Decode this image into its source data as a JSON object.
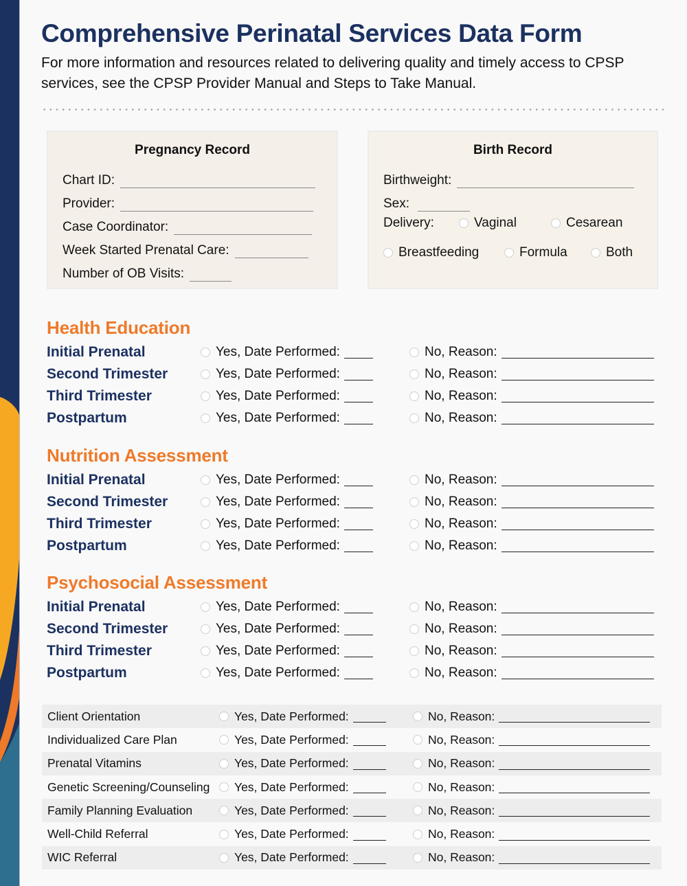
{
  "header": {
    "title": "Comprehensive Perinatal Services Data Form",
    "intro": "For more information and resources related to delivering quality and timely access to CPSP services, see the CPSP Provider Manual and Steps to Take Manual."
  },
  "colors": {
    "navy": "#1b3160",
    "orange_heading": "#ee7a2a",
    "accent_yellow": "#f7a823",
    "accent_orange": "#ee7a2a",
    "accent_teal": "#2e6e8e",
    "box_beige": "#f5efe9"
  },
  "pregnancy_record": {
    "title": "Pregnancy Record",
    "fields": [
      {
        "label": "Chart ID:",
        "value": ""
      },
      {
        "label": "Provider:",
        "value": ""
      },
      {
        "label": "Case Coordinator:",
        "value": ""
      },
      {
        "label": "Week Started Prenatal Care:",
        "value": ""
      },
      {
        "label": "Number of OB Visits:",
        "value": ""
      }
    ]
  },
  "birth_record": {
    "title": "Birth Record",
    "birthweight_label": "Birthweight:",
    "sex_label": "Sex:",
    "delivery_label": "Delivery:",
    "delivery_options": [
      "Vaginal",
      "Cesarean"
    ],
    "feeding_options": [
      "Breastfeeding",
      "Formula",
      "Both"
    ]
  },
  "yes_label": "Yes, Date Performed:",
  "no_label": "No, Reason:",
  "sections": [
    {
      "title": "Health Education",
      "rows": [
        "Initial Prenatal",
        "Second Trimester",
        "Third Trimester",
        "Postpartum"
      ]
    },
    {
      "title": "Nutrition Assessment",
      "rows": [
        "Initial Prenatal",
        "Second Trimester",
        "Third Trimester",
        "Postpartum"
      ]
    },
    {
      "title": "Psychosocial Assessment",
      "rows": [
        "Initial Prenatal",
        "Second Trimester",
        "Third Trimester",
        "Postpartum"
      ]
    }
  ],
  "services": [
    "Client Orientation",
    "Individualized Care Plan",
    "Prenatal Vitamins",
    "Genetic Screening/Counseling",
    "Family Planning Evaluation",
    "Well-Child Referral",
    "WIC Referral"
  ]
}
